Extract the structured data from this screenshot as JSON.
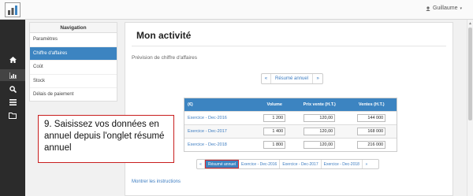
{
  "header": {
    "user_name": "Guillaume",
    "user_caret": "▾"
  },
  "sidebar_icons": [
    "home-icon",
    "chart-icon",
    "search-icon",
    "list-icon",
    "folder-icon"
  ],
  "navigation": {
    "title": "Navigation",
    "items": [
      {
        "label": "Paramètres",
        "active": false
      },
      {
        "label": "Chiffre d'affaires",
        "active": true
      },
      {
        "label": "Coût",
        "active": false
      },
      {
        "label": "Stock",
        "active": false
      },
      {
        "label": "Délais de paiement",
        "active": false
      }
    ]
  },
  "main": {
    "title": "Mon activité",
    "subtitle": "Prévision de chiffre d'affaires",
    "pager_top": {
      "prev": "«",
      "label": "Résumé annuel",
      "next": "»"
    },
    "table": {
      "headers": [
        "(€)",
        "Volume",
        "Prix vente (H.T.)",
        "Ventes (H.T.)"
      ],
      "rows": [
        {
          "label": "Exercice - Dec-2016",
          "volume": "1 200",
          "prix": "120,00",
          "ventes": "144 000"
        },
        {
          "label": "Exercice - Dec-2017",
          "volume": "1 400",
          "prix": "120,00",
          "ventes": "168 000"
        },
        {
          "label": "Exercice - Dec-2018",
          "volume": "1 800",
          "prix": "120,00",
          "ventes": "216 000"
        }
      ]
    },
    "pager_bottom": {
      "prev": "«",
      "items": [
        "Résumé annuel",
        "Exercice - Dec-2016",
        "Exercice - Dec-2017",
        "Exercice - Dec-2018"
      ],
      "next": "»"
    },
    "show_instructions": "Montrer les instructions"
  },
  "callout": {
    "text": "9. Saisissez vos données en annuel depuis l'onglet résumé annuel"
  },
  "colors": {
    "accent": "#3c84c1",
    "annotation_border": "#c81e1e",
    "sidebar_dark": "#2b2b2b"
  }
}
